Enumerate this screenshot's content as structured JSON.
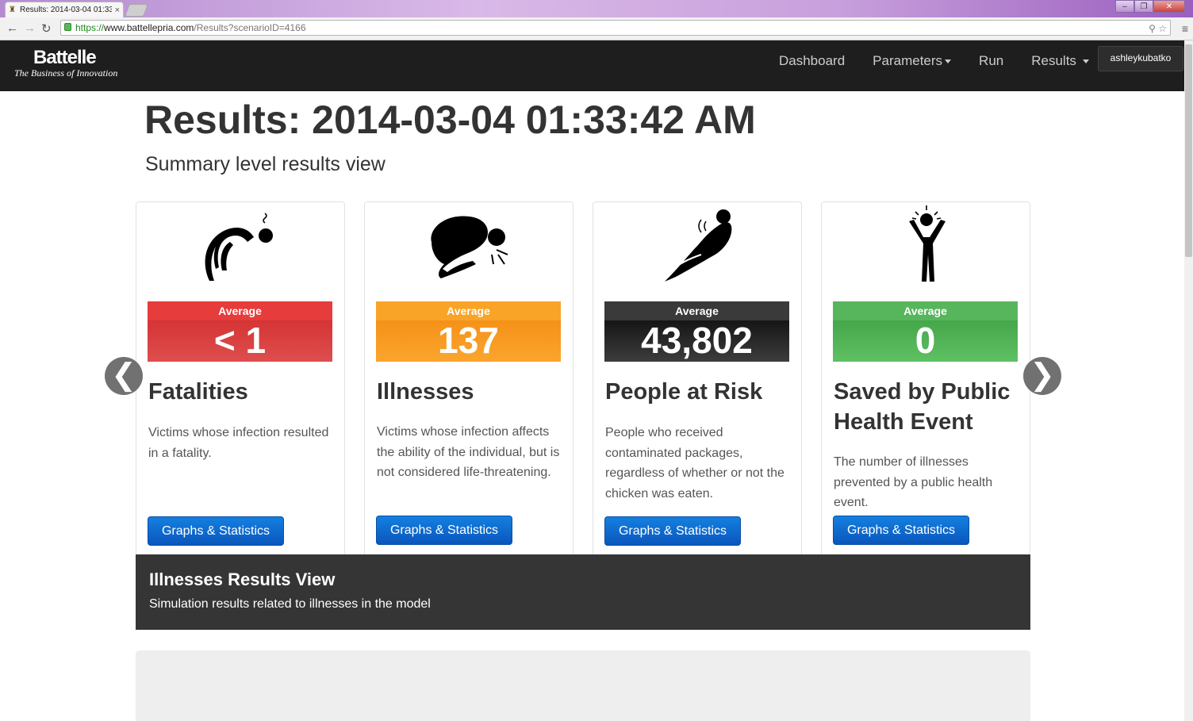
{
  "browser": {
    "tab_title": "Results: 2014-03-04 01:33:4",
    "tab_close": "×",
    "url_scheme": "https://",
    "url_host": "www.battellepria.com",
    "url_path": "/Results?scenarioID=4166"
  },
  "navbar": {
    "brand_name": "Battelle",
    "brand_tagline": "The Business of Innovation",
    "links": [
      "Dashboard",
      "Parameters",
      "Run",
      "Results"
    ],
    "user": "ashleykubatko"
  },
  "page": {
    "title": "Results: 2014-03-04 01:33:42 AM",
    "subtitle": "Summary level results view"
  },
  "cards": [
    {
      "badge_label": "Average",
      "value": "< 1",
      "title": "Fatalities",
      "description": "Victims whose infection resulted in a fatality.",
      "button": "Graphs & Statistics",
      "color": "#d53435",
      "icon": "fatality-figure-icon"
    },
    {
      "badge_label": "Average",
      "value": "137",
      "title": "Illnesses",
      "description": "Victims whose infection affects the ability of the individual, but is not considered life-threatening.",
      "button": "Graphs & Statistics",
      "color": "#f59119",
      "icon": "ill-figure-icon"
    },
    {
      "badge_label": "Average",
      "value": "43,802",
      "title": "People at Risk",
      "description": "People who received contaminated packages, regardless of whether or not the chicken was eaten.",
      "button": "Graphs & Statistics",
      "color": "#151515",
      "icon": "at-risk-figure-icon"
    },
    {
      "badge_label": "Average",
      "value": "0",
      "title": "Saved by Public Health Event",
      "description": "The number of illnesses prevented by a public health event.",
      "button": "Graphs & Statistics",
      "color": "#45a64a",
      "icon": "saved-figure-icon"
    }
  ],
  "carousel": {
    "prev": "❮",
    "next": "❯",
    "caption_title": "Illnesses Results View",
    "caption_text": "Simulation results related to illnesses in the model"
  }
}
